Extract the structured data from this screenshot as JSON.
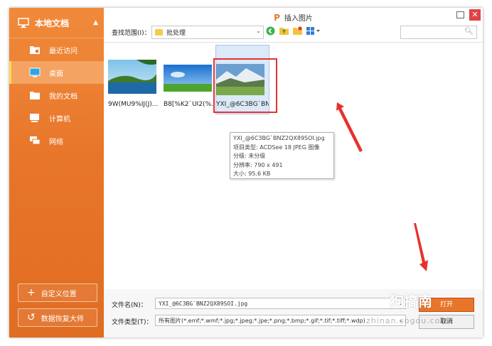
{
  "sidebar": {
    "title": "本地文档",
    "items": [
      {
        "label": "最近访问",
        "icon": "recent-folder-icon"
      },
      {
        "label": "桌面",
        "icon": "desktop-icon"
      },
      {
        "label": "我的文档",
        "icon": "folder-icon"
      },
      {
        "label": "计算机",
        "icon": "computer-icon"
      },
      {
        "label": "网络",
        "icon": "network-icon"
      }
    ],
    "active_index": 1,
    "custom_location": "自定义位置",
    "data_recovery": "数据恢复大师"
  },
  "dialog": {
    "title": "插入图片",
    "lookin_label": "查找范围(I)：",
    "lookin_value": "批处理"
  },
  "files": [
    {
      "name": "9W(MU9%IJ(J)..."
    },
    {
      "name": "B8[%K2`UI2(%..."
    },
    {
      "name": "YXI_@6C3BG`BNZ2QX89SOI.jpg"
    }
  ],
  "tooltip": {
    "filename": "YXI_@6C3BG`BNZ2QX89SOI.jpg",
    "type": "项目类型: ACDSee 18 JPEG 图像",
    "rating": "分级: 未分级",
    "resolution": "分辨率: 790 x 491",
    "size": "大小: 95.6 KB"
  },
  "bottom": {
    "filename_label": "文件名(N)：",
    "filename_value": "YXI_@6C3BG`BNZ2QX89SOI.jpg",
    "filetype_label": "文件类型(T)：",
    "filetype_value": "所有图片(*.emf;*.wmf;*.jpg;*.jpeg;*.jpe;*.png;*.bmp;*.gif;*.tif;*.tiff;*.wdp)",
    "open_button": "打开",
    "cancel_button": "取消"
  },
  "watermark": {
    "text": "狗搞南",
    "url": "zhinan.sogou.com"
  },
  "colors": {
    "sidebar": "#e8762a",
    "highlight": "#e5322e",
    "accent": "#e8762a"
  }
}
